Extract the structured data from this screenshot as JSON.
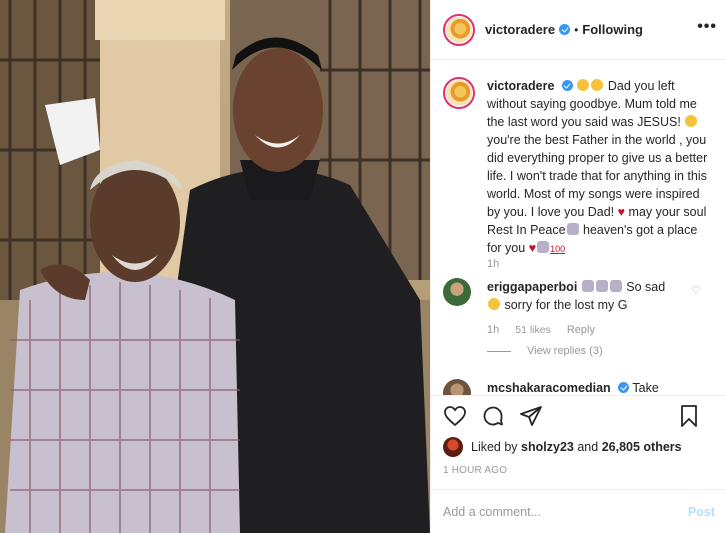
{
  "post": {
    "author": "victoradere",
    "following_label": "Following",
    "dot": "•",
    "more_label": "•••"
  },
  "caption": {
    "username": "victoradere",
    "text": "Dad you left without saying goodbye. Mum told me the last word you said was JESUS!",
    "text2": "you're the best Father in the world , you did everything proper to give us a better life. I won't trade that for anything in this world. Most of my songs were inspired by you. I love you Dad!",
    "text3": "may your soul Rest In Peace",
    "text4": "heaven's got a place for you",
    "badge": "100",
    "time": "1h"
  },
  "reply": {
    "username": "eriggapaperboi",
    "text1": "So sad",
    "text2": "sorry for the lost my G",
    "time": "1h",
    "likes": "51 likes",
    "reply_label": "Reply",
    "view_replies": "View replies (3)"
  },
  "third_comment": {
    "username": "mcshakaracomedian",
    "text": "Take"
  },
  "likes": {
    "liked_by_prefix": "Liked by",
    "liked_user": "sholzy23",
    "and_label": "and",
    "others": "26,805 others"
  },
  "timestamp": "1 HOUR AGO",
  "comment_box": {
    "placeholder": "Add a comment...",
    "post_label": "Post"
  },
  "icons": {
    "like": "heart-icon",
    "comment": "comment-icon",
    "share": "share-icon",
    "save": "bookmark-icon"
  },
  "colors": {
    "verified": "#3897f0",
    "post_disabled": "#b2dffc",
    "heart_emoji": "#c8102e",
    "muted": "#999999",
    "border": "#efefef"
  }
}
